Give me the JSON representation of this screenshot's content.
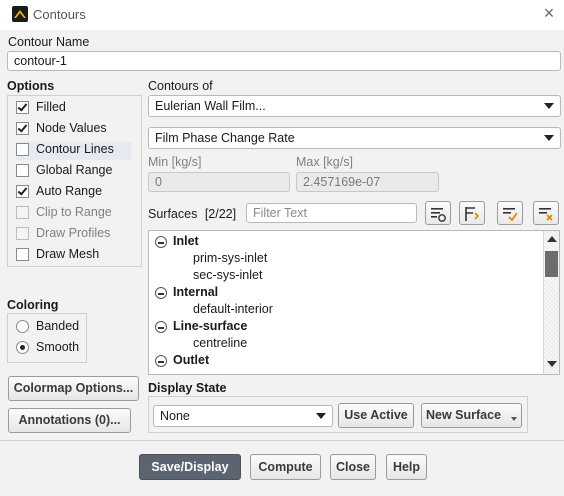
{
  "window": {
    "title": "Contours"
  },
  "contour_name": {
    "label": "Contour Name",
    "value": "contour-1"
  },
  "options": {
    "header": "Options",
    "items": [
      {
        "label": "Filled",
        "checked": true,
        "enabled": true
      },
      {
        "label": "Node Values",
        "checked": true,
        "enabled": true
      },
      {
        "label": "Contour Lines",
        "checked": false,
        "enabled": true
      },
      {
        "label": "Global Range",
        "checked": false,
        "enabled": true
      },
      {
        "label": "Auto Range",
        "checked": true,
        "enabled": true
      },
      {
        "label": "Clip to Range",
        "checked": false,
        "enabled": false
      },
      {
        "label": "Draw Profiles",
        "checked": false,
        "enabled": false
      },
      {
        "label": "Draw Mesh",
        "checked": false,
        "enabled": true
      }
    ]
  },
  "contours_of": {
    "label": "Contours of",
    "category": "Eulerian Wall Film...",
    "variable": "Film Phase Change Rate"
  },
  "range": {
    "min_label": "Min [kg/s]",
    "min_value": "0",
    "max_label": "Max [kg/s]",
    "max_value": "2.457169e-07"
  },
  "surfaces": {
    "label": "Surfaces",
    "count": "[2/22]",
    "filter_placeholder": "Filter Text",
    "groups": [
      {
        "name": "Inlet",
        "items": [
          "prim-sys-inlet",
          "sec-sys-inlet"
        ]
      },
      {
        "name": "Internal",
        "items": [
          "default-interior"
        ]
      },
      {
        "name": "Line-surface",
        "items": [
          "centreline"
        ]
      },
      {
        "name": "Outlet",
        "items": []
      }
    ]
  },
  "coloring": {
    "header": "Coloring",
    "options": [
      {
        "label": "Banded",
        "selected": false
      },
      {
        "label": "Smooth",
        "selected": true
      }
    ]
  },
  "buttons": {
    "colormap": "Colormap Options...",
    "annotations": "Annotations (0)...",
    "use_active": "Use Active",
    "new_surface": "New Surface",
    "save_display": "Save/Display",
    "compute": "Compute",
    "close": "Close",
    "help": "Help"
  },
  "display_state": {
    "label": "Display State",
    "value": "None"
  },
  "colors": {
    "primary_button": "#5b6470",
    "highlight": "#e5e9f0"
  }
}
